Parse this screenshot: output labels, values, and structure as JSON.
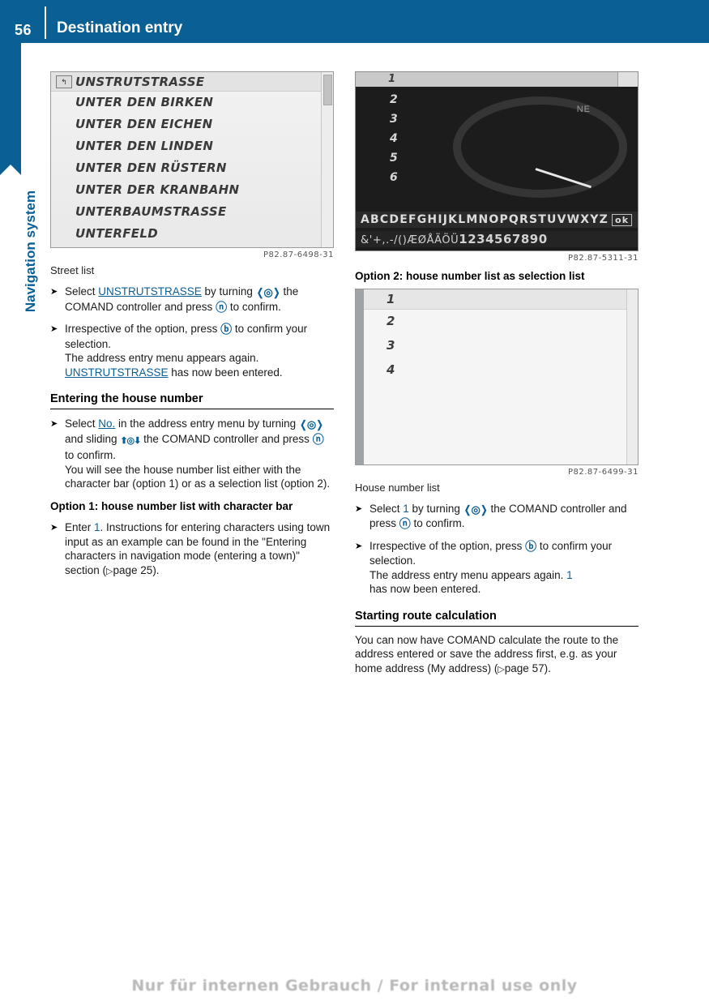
{
  "header": {
    "page_number": "56",
    "title": "Destination entry"
  },
  "side_tab": {
    "chapter_label": "Navigation system"
  },
  "left_column": {
    "figure_streetlist": {
      "back_icon_glyph": "↰",
      "items": [
        "UNSTRUTSTRASSE",
        "UNTER DEN BIRKEN",
        "UNTER DEN EICHEN",
        "UNTER DEN LINDEN",
        "UNTER DEN RÜSTERN",
        "UNTER DER KRANBAHN",
        "UNTERBAUMSTRASSE",
        "UNTERFELD"
      ],
      "caption_code": "P82.87-6498-31"
    },
    "figure_label": "Street list",
    "bullets": [
      {
        "parts": [
          {
            "t": "Select ",
            "s": "plain"
          },
          {
            "t": "UNSTRUTSTRASSE",
            "s": "hi-u"
          },
          {
            "t": " by turning ",
            "s": "plain"
          },
          {
            "t": "",
            "s": "ctrl-lr"
          },
          {
            "t": " the COMAND controller and press ",
            "s": "plain"
          },
          {
            "t": "",
            "s": "ctrl-press"
          },
          {
            "t": " to confirm.",
            "s": "plain"
          }
        ]
      },
      {
        "parts": [
          {
            "t": "Irrespective of the option, press ",
            "s": "plain"
          },
          {
            "t": "",
            "s": "ctrl-back"
          },
          {
            "t": " to confirm your selection.",
            "s": "plain"
          },
          {
            "t": "\nThe address entry menu appears again.\n",
            "s": "plain"
          },
          {
            "t": "UNSTRUTSTRASSE",
            "s": "hi-u"
          },
          {
            "t": " has now been entered.",
            "s": "plain"
          }
        ]
      }
    ],
    "heading_house_number": "Entering the house number",
    "bullet_house_number": {
      "parts": [
        {
          "t": "Select ",
          "s": "plain"
        },
        {
          "t": "No.",
          "s": "hi-u"
        },
        {
          "t": " in the address entry menu by turning ",
          "s": "plain"
        },
        {
          "t": "",
          "s": "ctrl-lr"
        },
        {
          "t": " and sliding ",
          "s": "plain"
        },
        {
          "t": "",
          "s": "ctrl-ud"
        },
        {
          "t": " the COMAND controller and press ",
          "s": "plain"
        },
        {
          "t": "",
          "s": "ctrl-press"
        },
        {
          "t": " to confirm.",
          "s": "plain"
        },
        {
          "t": "\nYou will see the house number list either with the character bar (option 1) or as a selection list (option 2).",
          "s": "plain"
        }
      ]
    },
    "heading_option1": "Option 1: house number list with character bar",
    "bullet_option1": {
      "parts": [
        {
          "t": "Enter ",
          "s": "plain"
        },
        {
          "t": "1",
          "s": "hi"
        },
        {
          "t": ". Instructions for entering characters using town input as an example can be found in the \"Entering characters in navigation mode (entering a town)\" section (",
          "s": "plain"
        },
        {
          "t": "▷ page 25",
          "s": "pgref"
        },
        {
          "t": ").",
          "s": "plain"
        }
      ]
    }
  },
  "right_column": {
    "figure_charbar": {
      "top_number": "1",
      "number_column": [
        "2",
        "3",
        "4",
        "5",
        "6"
      ],
      "compass_label": "NE",
      "alpha_row": "ABCDEFGHIJKLMNOPQRSTUVWXYZ",
      "alpha_ok": "ok",
      "symbol_row_prefix": "&'+,.-/()ÆØÅÄÖÜ",
      "symbol_row_digits": "1234567890",
      "caption_code": "P82.87-5311-31"
    },
    "heading_option2": "Option 2: house number list as selection list",
    "figure_hnlist": {
      "items": [
        "1",
        "2",
        "3",
        "4"
      ],
      "caption_code": "P82.87-6499-31"
    },
    "figure_label": "House number list",
    "bullets": [
      {
        "parts": [
          {
            "t": "Select ",
            "s": "plain"
          },
          {
            "t": "1",
            "s": "hi"
          },
          {
            "t": " by turning ",
            "s": "plain"
          },
          {
            "t": "",
            "s": "ctrl-lr"
          },
          {
            "t": " the COMAND controller and press ",
            "s": "plain"
          },
          {
            "t": "",
            "s": "ctrl-press"
          },
          {
            "t": " to confirm.",
            "s": "plain"
          }
        ]
      },
      {
        "parts": [
          {
            "t": "Irrespective of the option, press ",
            "s": "plain"
          },
          {
            "t": "",
            "s": "ctrl-back"
          },
          {
            "t": " to confirm your selection.",
            "s": "plain"
          },
          {
            "t": "\nThe address entry menu appears again. ",
            "s": "plain"
          },
          {
            "t": "1",
            "s": "hi"
          },
          {
            "t": "\nhas now been entered.",
            "s": "plain"
          }
        ]
      }
    ],
    "heading_route": "Starting route calculation",
    "paragraph_route": {
      "parts": [
        {
          "t": "You can now have COMAND calculate the route to the address entered or save the address first, e.g. as your home address (My address) (",
          "s": "plain"
        },
        {
          "t": "▷ page 57",
          "s": "pgref"
        },
        {
          "t": ").",
          "s": "plain"
        }
      ]
    }
  },
  "footer": {
    "text": "Nur für internen Gebrauch / For internal use only"
  }
}
